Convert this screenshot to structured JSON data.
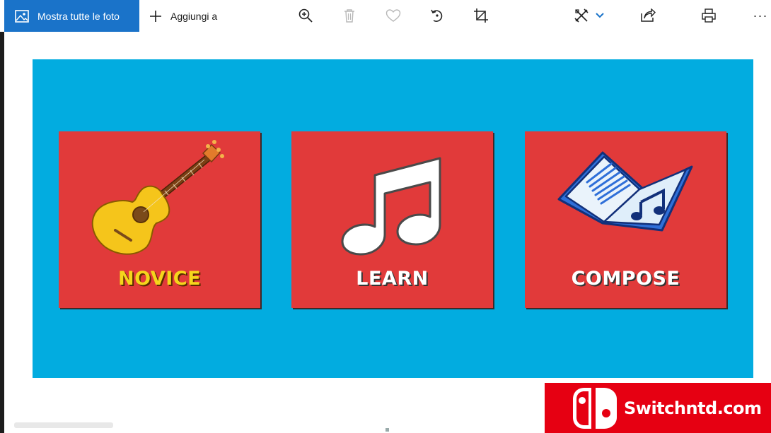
{
  "toolbar": {
    "show_all_label": "Mostra tutte le foto",
    "add_label": "Aggiungi a",
    "more_label": "···",
    "accent": "#1a73c9",
    "icons": [
      "zoom-icon",
      "delete-icon",
      "favorite-icon",
      "rotate-icon",
      "crop-icon",
      "edit-create-icon",
      "chevron-down-icon",
      "share-icon",
      "print-icon",
      "more-icon"
    ]
  },
  "photo": {
    "background": "#02ace0",
    "cards": [
      {
        "label": "NOVICE",
        "icon": "guitar-icon",
        "color": "#e13a3a"
      },
      {
        "label": "LEARN",
        "icon": "music-note-icon",
        "color": "#e13a3a"
      },
      {
        "label": "COMPOSE",
        "icon": "songbook-icon",
        "color": "#e13a3a"
      }
    ]
  },
  "watermark": {
    "text": "Switchntd.com",
    "color": "#e60012"
  }
}
